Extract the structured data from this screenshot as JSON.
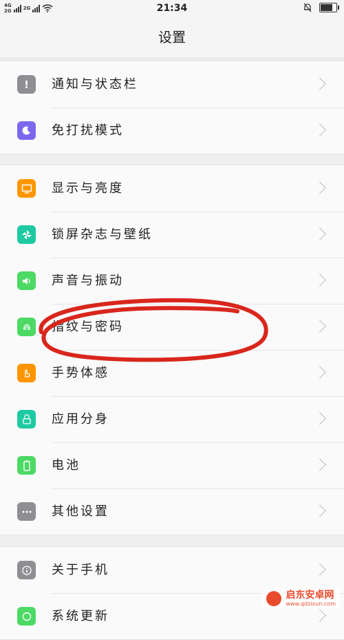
{
  "status": {
    "net_top": "4G",
    "net_bottom": "2G",
    "net2": "2G",
    "time": "21:34"
  },
  "title": "设置",
  "groups": [
    {
      "items": [
        {
          "label": "通知与状态栏",
          "icon": "notification-icon",
          "color": "#8e8e93"
        },
        {
          "label": "免打扰模式",
          "icon": "moon-icon",
          "color": "#7b68ee"
        }
      ]
    },
    {
      "items": [
        {
          "label": "显示与亮度",
          "icon": "display-icon",
          "color": "#ff9500"
        },
        {
          "label": "锁屏杂志与壁纸",
          "icon": "pinwheel-icon",
          "color": "#1fcaa3"
        },
        {
          "label": "声音与振动",
          "icon": "speaker-icon",
          "color": "#4cd964"
        },
        {
          "label": "指纹与密码",
          "icon": "fingerprint-icon",
          "color": "#4cd964"
        },
        {
          "label": "手势体感",
          "icon": "gesture-hand-icon",
          "color": "#ff9500"
        },
        {
          "label": "应用分身",
          "icon": "app-clone-icon",
          "color": "#1fcaa3"
        },
        {
          "label": "电池",
          "icon": "battery-icon",
          "color": "#4cd964"
        },
        {
          "label": "其他设置",
          "icon": "more-icon",
          "color": "#8e8e93"
        }
      ]
    },
    {
      "items": [
        {
          "label": "关于手机",
          "icon": "info-icon",
          "color": "#8e8e93"
        },
        {
          "label": "系统更新",
          "icon": "update-icon",
          "color": "#4cd964"
        }
      ]
    }
  ],
  "annotation_color": "#d9261c",
  "watermark": {
    "text": "启东安卓网",
    "url": "www.qdzixun.com"
  }
}
